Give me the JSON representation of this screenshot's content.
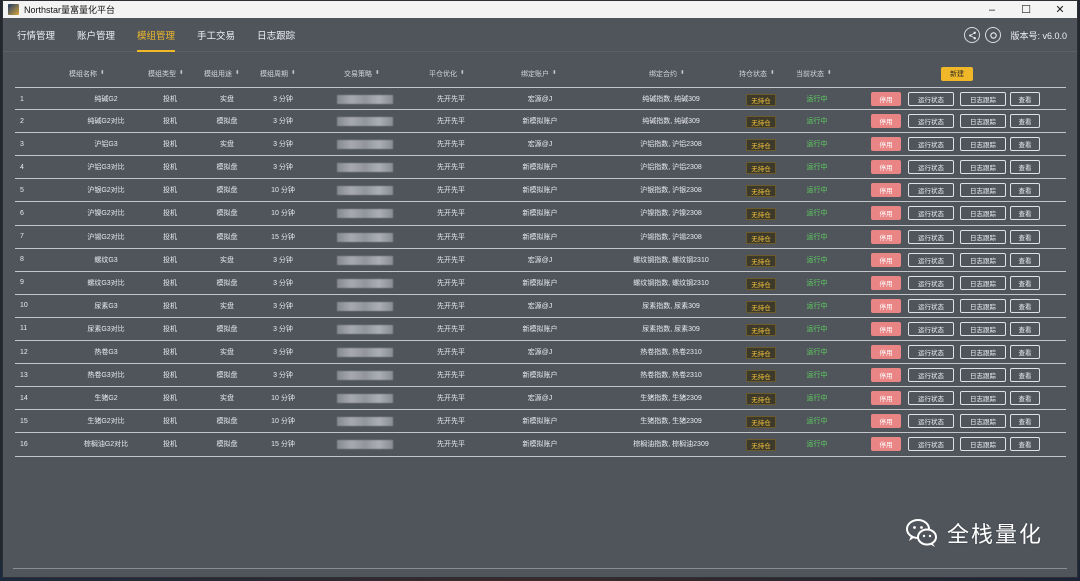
{
  "window": {
    "title": "Northstar量富量化平台",
    "controls": [
      "–",
      "☐",
      "✕"
    ]
  },
  "nav": {
    "tabs": [
      "行情管理",
      "账户管理",
      "模组管理",
      "手工交易",
      "日志跟踪"
    ],
    "active_index": 2,
    "version_label": "版本号: v6.0.0"
  },
  "table": {
    "headers": [
      "模组名称",
      "模组类型",
      "模组用途",
      "模组周期",
      "交易策略",
      "平仓优化",
      "绑定账户",
      "绑定合约",
      "持仓状态",
      "当前状态"
    ],
    "new_button": "新建",
    "action_labels": {
      "stop": "停用",
      "status": "运行状态",
      "log": "日志跟踪",
      "view": "查看"
    },
    "rows": [
      {
        "id": "1",
        "name": "纯碱G2",
        "type": "投机",
        "use": "实盘",
        "period": "3 分钟",
        "close": "先开先平",
        "account": "宏源@J",
        "contract": "纯碱指数, 纯碱309",
        "pos": "无持仓",
        "state": "运行中"
      },
      {
        "id": "2",
        "name": "纯碱G2对比",
        "type": "投机",
        "use": "模拟盘",
        "period": "3 分钟",
        "close": "先开先平",
        "account": "新模拟账户",
        "contract": "纯碱指数, 纯碱309",
        "pos": "无持仓",
        "state": "运行中"
      },
      {
        "id": "3",
        "name": "沪铝G3",
        "type": "投机",
        "use": "实盘",
        "period": "3 分钟",
        "close": "先开先平",
        "account": "宏源@J",
        "contract": "沪铝指数, 沪铝2308",
        "pos": "无持仓",
        "state": "运行中"
      },
      {
        "id": "4",
        "name": "沪铝G3对比",
        "type": "投机",
        "use": "模拟盘",
        "period": "3 分钟",
        "close": "先开先平",
        "account": "新模拟账户",
        "contract": "沪铝指数, 沪铝2308",
        "pos": "无持仓",
        "state": "运行中"
      },
      {
        "id": "5",
        "name": "沪银G2对比",
        "type": "投机",
        "use": "模拟盘",
        "period": "10 分钟",
        "close": "先开先平",
        "account": "新模拟账户",
        "contract": "沪银指数, 沪银2308",
        "pos": "无持仓",
        "state": "运行中"
      },
      {
        "id": "6",
        "name": "沪镍G2对比",
        "type": "投机",
        "use": "模拟盘",
        "period": "10 分钟",
        "close": "先开先平",
        "account": "新模拟账户",
        "contract": "沪镍指数, 沪镍2308",
        "pos": "无持仓",
        "state": "运行中"
      },
      {
        "id": "7",
        "name": "沪锡G2对比",
        "type": "投机",
        "use": "模拟盘",
        "period": "15 分钟",
        "close": "先开先平",
        "account": "新模拟账户",
        "contract": "沪锡指数, 沪锡2308",
        "pos": "无持仓",
        "state": "运行中"
      },
      {
        "id": "8",
        "name": "螺纹G3",
        "type": "投机",
        "use": "实盘",
        "period": "3 分钟",
        "close": "先开先平",
        "account": "宏源@J",
        "contract": "螺纹钢指数, 螺纹钢2310",
        "pos": "无持仓",
        "state": "运行中"
      },
      {
        "id": "9",
        "name": "螺纹G3对比",
        "type": "投机",
        "use": "模拟盘",
        "period": "3 分钟",
        "close": "先开先平",
        "account": "新模拟账户",
        "contract": "螺纹钢指数, 螺纹钢2310",
        "pos": "无持仓",
        "state": "运行中"
      },
      {
        "id": "10",
        "name": "尿素G3",
        "type": "投机",
        "use": "实盘",
        "period": "3 分钟",
        "close": "先开先平",
        "account": "宏源@J",
        "contract": "尿素指数, 尿素309",
        "pos": "无持仓",
        "state": "运行中"
      },
      {
        "id": "11",
        "name": "尿素G3对比",
        "type": "投机",
        "use": "模拟盘",
        "period": "3 分钟",
        "close": "先开先平",
        "account": "新模拟账户",
        "contract": "尿素指数, 尿素309",
        "pos": "无持仓",
        "state": "运行中"
      },
      {
        "id": "12",
        "name": "热卷G3",
        "type": "投机",
        "use": "实盘",
        "period": "3 分钟",
        "close": "先开先平",
        "account": "宏源@J",
        "contract": "热卷指数, 热卷2310",
        "pos": "无持仓",
        "state": "运行中"
      },
      {
        "id": "13",
        "name": "热卷G3对比",
        "type": "投机",
        "use": "模拟盘",
        "period": "3 分钟",
        "close": "先开先平",
        "account": "新模拟账户",
        "contract": "热卷指数, 热卷2310",
        "pos": "无持仓",
        "state": "运行中"
      },
      {
        "id": "14",
        "name": "生猪G2",
        "type": "投机",
        "use": "实盘",
        "period": "10 分钟",
        "close": "先开先平",
        "account": "宏源@J",
        "contract": "生猪指数, 生猪2309",
        "pos": "无持仓",
        "state": "运行中"
      },
      {
        "id": "15",
        "name": "生猪G2对比",
        "type": "投机",
        "use": "模拟盘",
        "period": "10 分钟",
        "close": "先开先平",
        "account": "新模拟账户",
        "contract": "生猪指数, 生猪2309",
        "pos": "无持仓",
        "state": "运行中"
      },
      {
        "id": "16",
        "name": "棕榈油G2对比",
        "type": "投机",
        "use": "模拟盘",
        "period": "15 分钟",
        "close": "先开先平",
        "account": "新模拟账户",
        "contract": "棕榈油指数, 棕榈油2309",
        "pos": "无持仓",
        "state": "运行中"
      }
    ]
  },
  "watermark": {
    "text": "全栈量化",
    "icon": "wechat-icon"
  },
  "colors": {
    "accent": "#f0b829",
    "stop_button": "#e98585",
    "running": "#5fcf5f",
    "window_bg": "#50555c"
  }
}
